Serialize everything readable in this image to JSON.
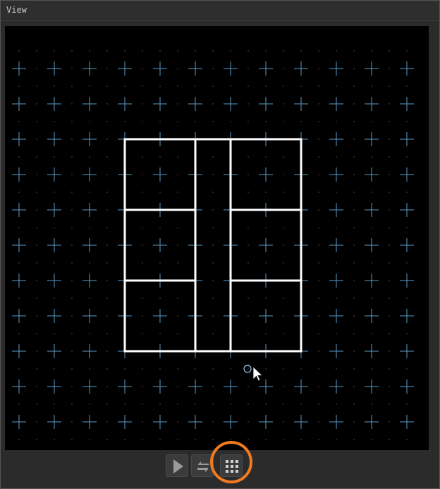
{
  "window": {
    "title": "View"
  },
  "colors": {
    "canvas_bg": "#000000",
    "grid_cross": "#5a9bc8",
    "grid_dot": "#8a9aa8",
    "shape_stroke": "#ffffff",
    "highlight": "#f07a20"
  },
  "toolbar": {
    "buttons": [
      {
        "name": "play-button",
        "icon": "play-icon"
      },
      {
        "name": "swap-button",
        "icon": "swap-icon"
      },
      {
        "name": "grid-toggle-button",
        "icon": "grid-icon",
        "highlighted": true
      }
    ]
  }
}
